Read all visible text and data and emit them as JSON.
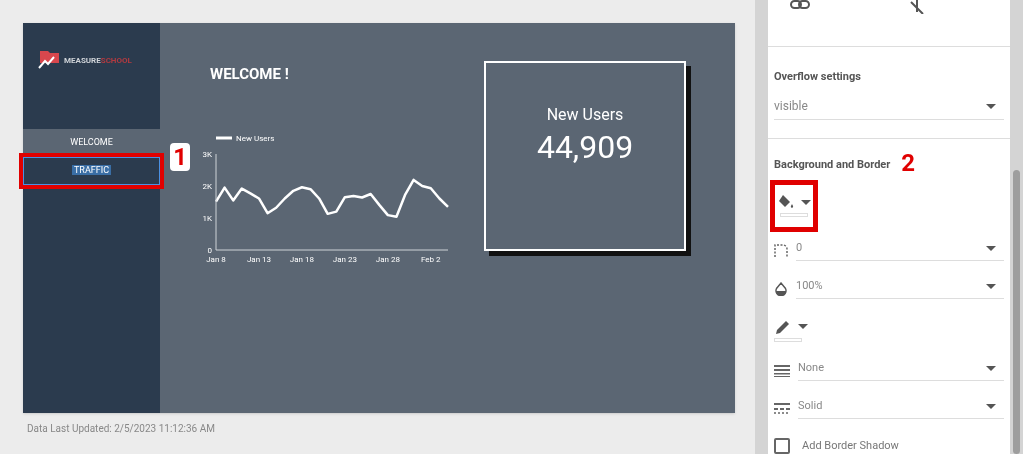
{
  "report": {
    "logo": {
      "part_1": "MEASURE",
      "part_2": "SCHOOL"
    },
    "nav": [
      {
        "label": "WELCOME",
        "current": true,
        "selected": false
      },
      {
        "label": "TRAFFIC",
        "current": false,
        "selected": true
      }
    ],
    "heading": "WELCOME !",
    "chart": {
      "chart_data": {
        "type": "line",
        "categories": [
          "Jan 8",
          null,
          null,
          null,
          null,
          "Jan 13",
          null,
          null,
          null,
          null,
          "Jan 18",
          null,
          null,
          null,
          null,
          "Jan 23",
          null,
          null,
          null,
          null,
          "Jan 28",
          null,
          null,
          null,
          null,
          "Feb 2",
          null,
          null
        ],
        "series": [
          {
            "name": "New Users",
            "color": "#ffffff",
            "values": [
              1510,
              1950,
              1550,
              1920,
              1770,
              1610,
              1150,
              1320,
              1610,
              1850,
              1960,
              1900,
              1610,
              1130,
              1200,
              1650,
              1690,
              1640,
              1750,
              1410,
              1090,
              1040,
              1720,
              2190,
              2000,
              1930,
              1610,
              1350
            ]
          }
        ],
        "ylim": [
          0,
          3000
        ],
        "yticks": [
          {
            "value": 0,
            "label": "0"
          },
          {
            "value": 1000,
            "label": "1K"
          },
          {
            "value": 2000,
            "label": "2K"
          },
          {
            "value": 3000,
            "label": "3K"
          }
        ]
      }
    },
    "scorecard": {
      "label": "New Users",
      "value": "44,909"
    },
    "footer": "Data Last Updated: 2/5/2023 11:12:36 AM"
  },
  "annotations": [
    {
      "label": "1"
    },
    {
      "label": "2"
    }
  ],
  "panel": {
    "overflow": {
      "label": "Overflow settings",
      "value": "visible"
    },
    "section_title": "Background and Border",
    "dropdowns": [
      {
        "value": "0"
      },
      {
        "value": "100%"
      },
      {
        "value": "None"
      },
      {
        "value": "Solid"
      }
    ],
    "shadow": {
      "label": "Add Border Shadow",
      "checked": false
    }
  }
}
